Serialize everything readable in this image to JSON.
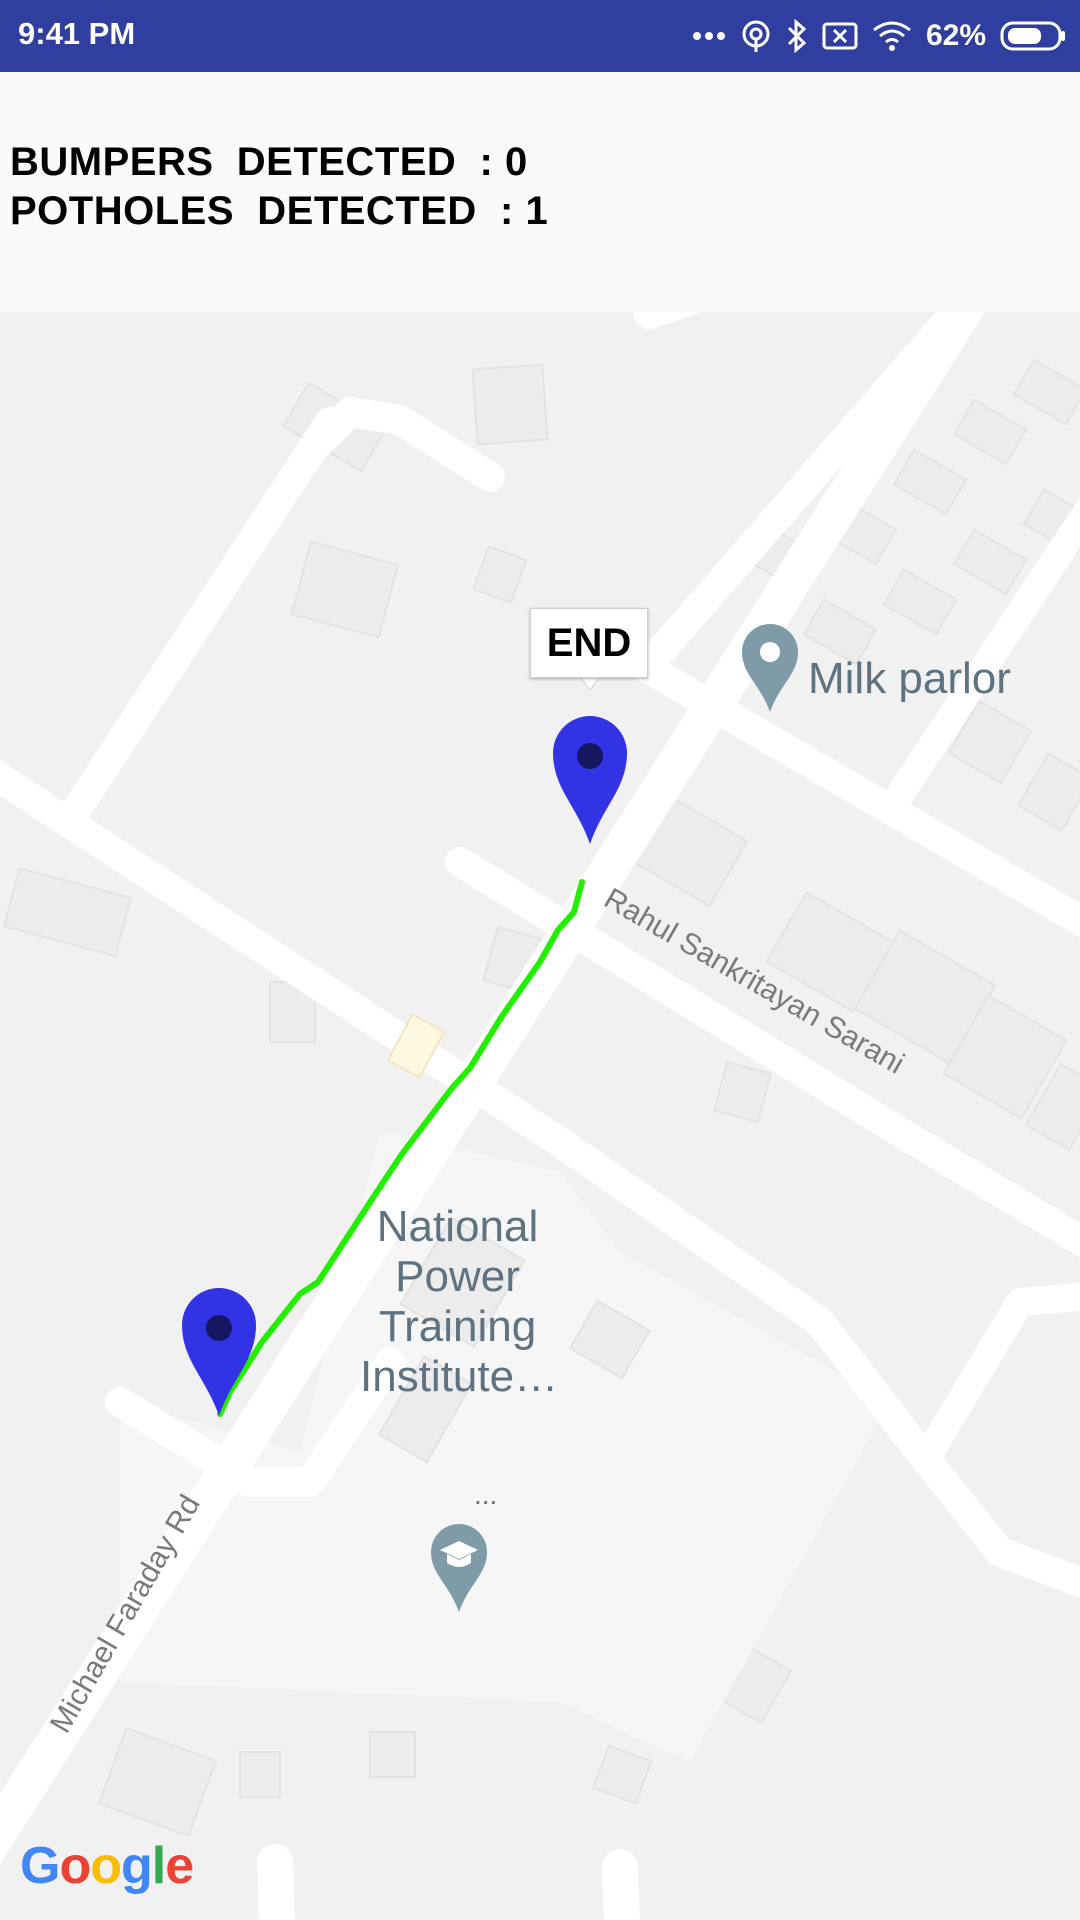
{
  "status_bar": {
    "time": "9:41 PM",
    "battery": "62%",
    "icons": [
      "more-dots-icon",
      "hotspot-icon",
      "bluetooth-icon",
      "no-sim-icon",
      "wifi-icon",
      "battery-icon"
    ]
  },
  "stats": {
    "bumpers": "BUMPERS  DETECTED  : 0",
    "potholes": "POTHOLES  DETECTED  : 1"
  },
  "map": {
    "end_marker_label": "END",
    "places": {
      "milk_parlor": "Milk parlor",
      "institute_line1": "National",
      "institute_line2": "Power",
      "institute_line3": "Training",
      "institute_line4": "Institute…",
      "ellipsis": "..."
    },
    "roads": {
      "rahul": "Rahul Sankritayan Sarani",
      "michael": "Michael Faraday Rd"
    },
    "route_color": "#22ee00",
    "marker_color": "#3333e6",
    "attribution": [
      "G",
      "o",
      "o",
      "g",
      "l",
      "e"
    ]
  }
}
